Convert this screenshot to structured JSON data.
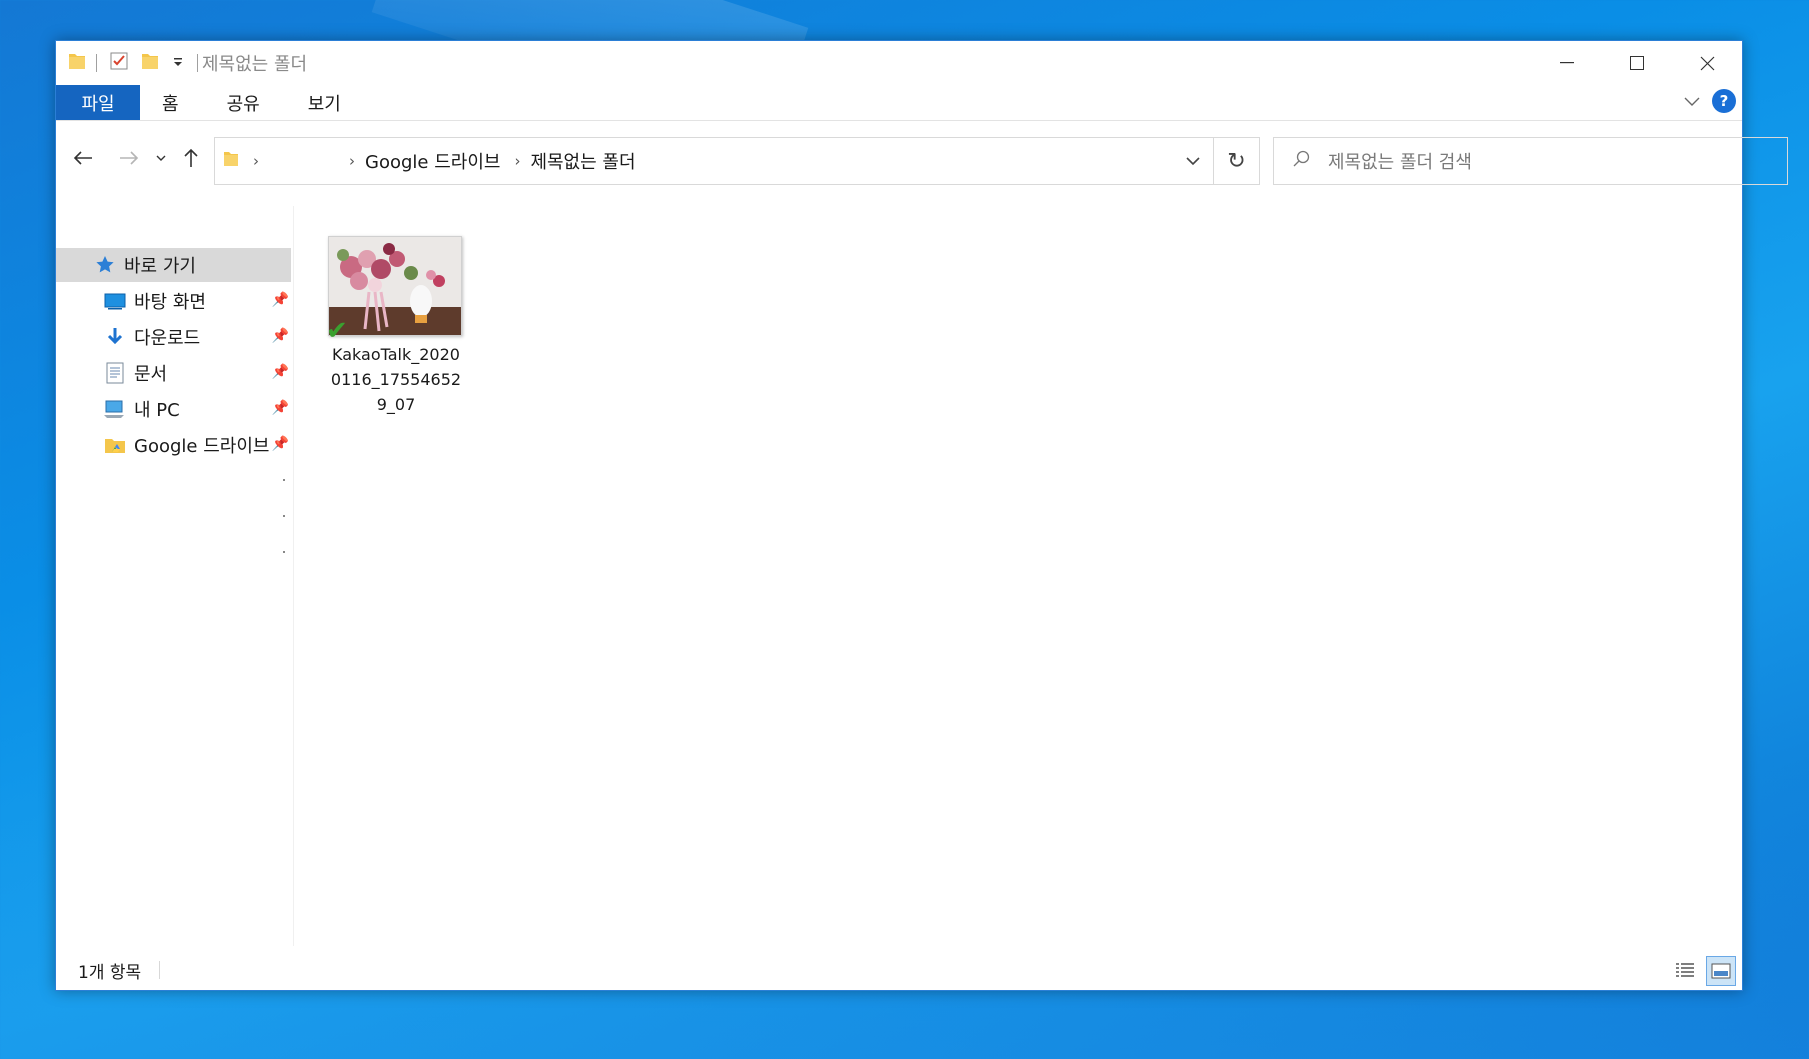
{
  "window": {
    "title": "제목없는 폴더",
    "controls": {
      "minimize": "—",
      "maximize": "☐",
      "close": "✕"
    }
  },
  "ribbon": {
    "tabs": [
      {
        "label": "파일",
        "active": true
      },
      {
        "label": "홈",
        "active": false
      },
      {
        "label": "공유",
        "active": false
      },
      {
        "label": "보기",
        "active": false
      }
    ],
    "help": "?"
  },
  "address_bar": {
    "breadcrumbs": [
      "Google 드라이브",
      "제목없는 폴더"
    ]
  },
  "search": {
    "placeholder": "제목없는 폴더 검색"
  },
  "nav_pane": {
    "quick_access": "바로 가기",
    "items": [
      {
        "label": "바탕 화면",
        "icon": "desktop-icon",
        "pinned": true
      },
      {
        "label": "다운로드",
        "icon": "download-icon",
        "pinned": true
      },
      {
        "label": "문서",
        "icon": "documents-icon",
        "pinned": true
      },
      {
        "label": "내 PC",
        "icon": "computer-icon",
        "pinned": true
      },
      {
        "label": "Google 드라이브",
        "icon": "google-drive-icon",
        "pinned": true
      }
    ]
  },
  "content": {
    "files": [
      {
        "name": "KakaoTalk_20200116_175546529_07",
        "type": "image",
        "synced": true
      }
    ]
  },
  "status_bar": {
    "item_count": "1개 항목"
  },
  "colors": {
    "accent": "#1565c0",
    "selected_nav": "#d9d9d9",
    "sync_check": "#3aa02f"
  }
}
